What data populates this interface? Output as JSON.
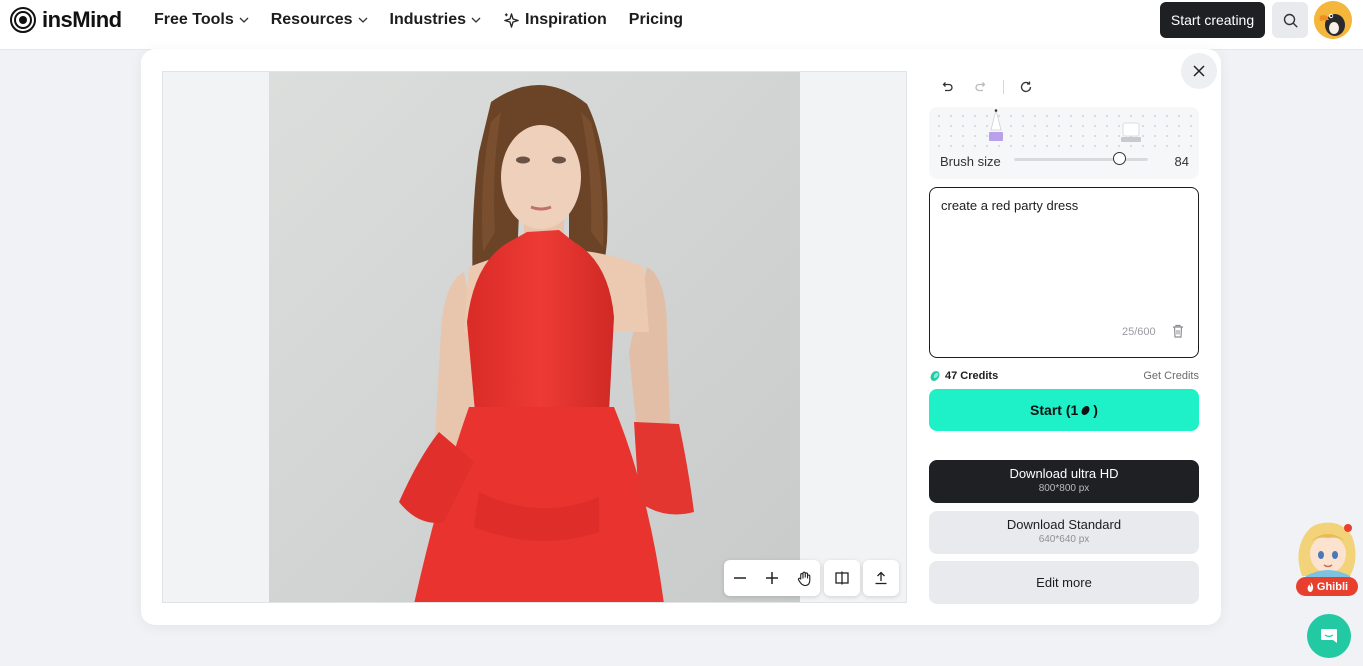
{
  "brand": {
    "name": "insMind"
  },
  "nav": {
    "items": [
      {
        "label": "Free Tools",
        "has_dropdown": true
      },
      {
        "label": "Resources",
        "has_dropdown": true
      },
      {
        "label": "Industries",
        "has_dropdown": true
      },
      {
        "label": "Inspiration",
        "has_dropdown": false,
        "icon": "sparkle-icon"
      },
      {
        "label": "Pricing",
        "has_dropdown": false
      }
    ],
    "start_creating": "Start creating"
  },
  "editor": {
    "brush": {
      "label": "Brush size",
      "value": "84",
      "level_percent": 82
    },
    "prompt": {
      "value": "create a red party dress",
      "count": "25/600"
    },
    "credits": {
      "label": "47 Credits",
      "get_credits": "Get Credits"
    },
    "start_button": {
      "label": "Start (1",
      "suffix": ")"
    },
    "download_hd": {
      "title": "Download ultra HD",
      "size": "800*800 px"
    },
    "download_standard": {
      "title": "Download Standard",
      "size": "640*640 px"
    },
    "edit_more": "Edit more"
  },
  "widgets": {
    "ghibli_label": "Ghibli"
  },
  "colors": {
    "accent": "#1ef0c8",
    "dark": "#1f2023",
    "badge": "#e8402f",
    "chat": "#22c9a3"
  }
}
